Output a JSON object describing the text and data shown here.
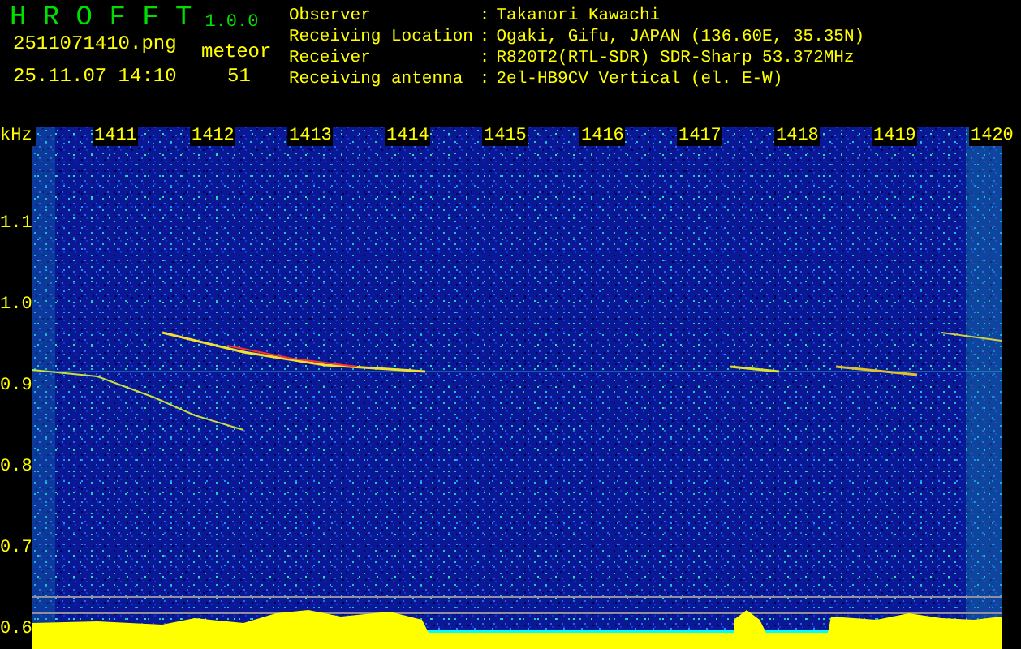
{
  "app": {
    "name": "H R O F F T",
    "version": "1.0.0"
  },
  "file": "2511071410.png",
  "timestamp": "25.11.07 14:10",
  "meteor": {
    "label": "meteor",
    "count": "51"
  },
  "info": [
    {
      "label": "Observer",
      "separator": ":",
      "value": "Takanori Kawachi"
    },
    {
      "label": "Receiving Location",
      "separator": ":",
      "value": "Ogaki, Gifu, JAPAN (136.60E, 35.35N)"
    },
    {
      "label": "Receiver",
      "separator": ":",
      "value": "R820T2(RTL-SDR) SDR-Sharp 53.372MHz"
    },
    {
      "label": "Receiving antenna",
      "separator": ":",
      "value": "2el-HB9CV Vertical (el. E-W)"
    }
  ],
  "axis": {
    "unit": "kHz",
    "time_labels": [
      "1411",
      "1412",
      "1413",
      "1414",
      "1415",
      "1416",
      "1417",
      "1418",
      "1419",
      "1420"
    ],
    "freq_labels": [
      "1.1",
      "1.0",
      "0.9",
      "0.8",
      "0.7",
      "0.6"
    ]
  }
}
